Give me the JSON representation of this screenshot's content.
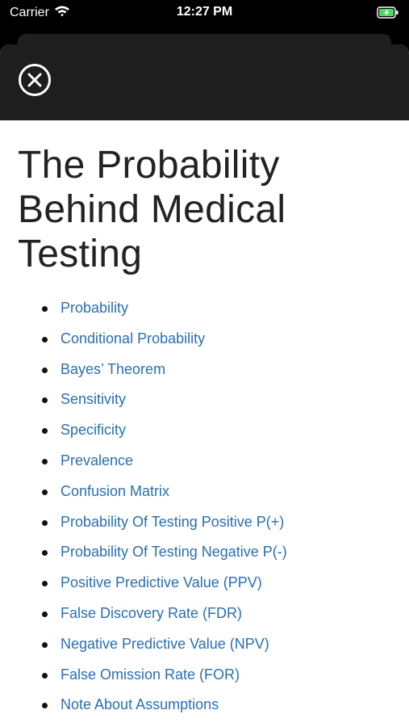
{
  "status_bar": {
    "carrier": "Carrier",
    "time": "12:27 PM"
  },
  "header": {
    "close_icon": "close-circle-icon"
  },
  "page": {
    "title": "The Probability Behind Medical Testing"
  },
  "topics": [
    {
      "label": "Probability"
    },
    {
      "label": "Conditional Probability"
    },
    {
      "label": "Bayes’ Theorem"
    },
    {
      "label": "Sensitivity"
    },
    {
      "label": "Specificity"
    },
    {
      "label": "Prevalence"
    },
    {
      "label": "Confusion Matrix"
    },
    {
      "label": "Probability Of Testing Positive P(+)"
    },
    {
      "label": "Probability Of Testing Negative P(-)"
    },
    {
      "label": "Positive Predictive Value (PPV)"
    },
    {
      "label": "False Discovery Rate (FDR)"
    },
    {
      "label": "Negative Predictive Value (NPV)"
    },
    {
      "label": "False Omission Rate (FOR)"
    },
    {
      "label": "Note About Assumptions"
    }
  ],
  "colors": {
    "link": "#2a6fb0",
    "header_background": "#1e1e1e",
    "battery_charging": "#4cd964"
  }
}
